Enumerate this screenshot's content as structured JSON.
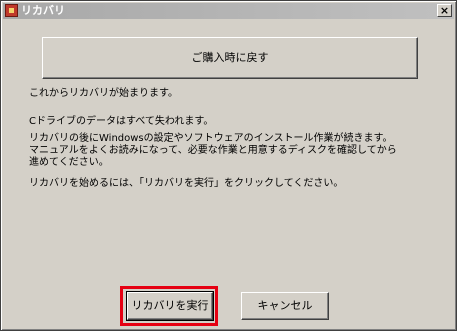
{
  "window": {
    "title": "リカバリ",
    "close_label": "×"
  },
  "main": {
    "back_button_label": "ご購入時に戻す",
    "paragraphs": [
      "これからリカバリが始まります。",
      "Cドライブのデータはすべて失われます。",
      "リカバリの後にWindowsの設定やソフトウェアのインストール作業が続きます。\nマニュアルをよくお読みになって、必要な作業と用意するディスクを確認してから\n進めてください。",
      "リカバリを始めるには、「リカバリを実行」をクリックしてください。"
    ]
  },
  "buttons": {
    "recover_label": "リカバリを実行",
    "cancel_label": "キャンセル"
  },
  "colors": {
    "highlight": "#e60012",
    "dialog_bg": "#d4d0c8"
  }
}
